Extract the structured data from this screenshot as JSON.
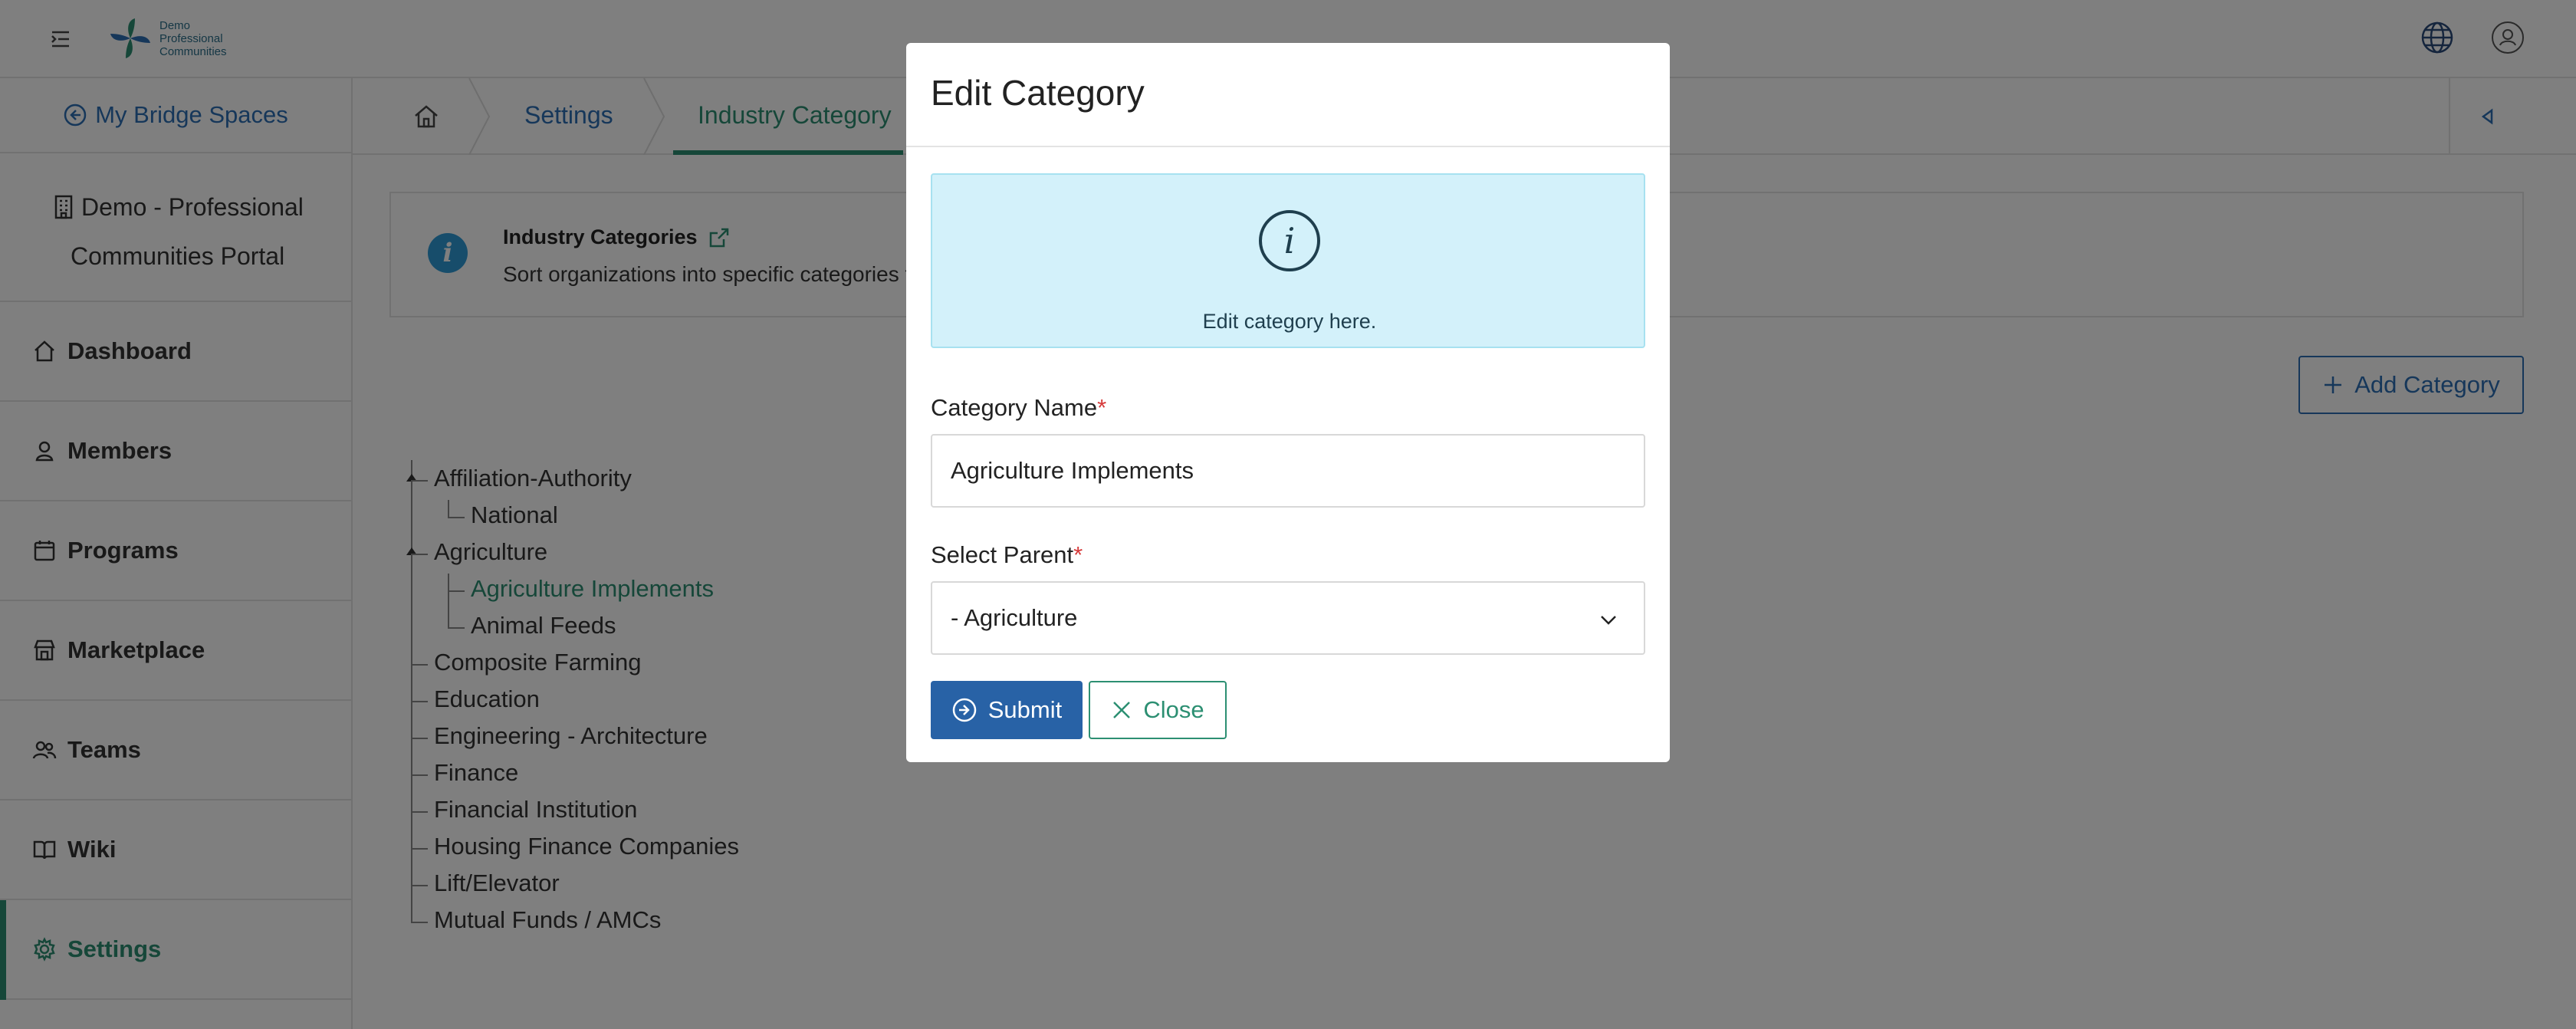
{
  "header": {
    "logo_lines": [
      "Demo",
      "Professional",
      "Communities"
    ]
  },
  "sidebar": {
    "bridge_label": "My Bridge Spaces",
    "org_line1": "Demo - Professional",
    "org_line2": "Communities Portal",
    "items": [
      {
        "label": "Dashboard",
        "icon": "home-icon"
      },
      {
        "label": "Members",
        "icon": "user-icon"
      },
      {
        "label": "Programs",
        "icon": "calendar-icon"
      },
      {
        "label": "Marketplace",
        "icon": "store-icon"
      },
      {
        "label": "Teams",
        "icon": "users-icon"
      },
      {
        "label": "Wiki",
        "icon": "book-icon"
      },
      {
        "label": "Settings",
        "icon": "gear-icon"
      }
    ],
    "active_item": "Settings"
  },
  "breadcrumb": {
    "items": [
      "Settings",
      "Industry Category"
    ]
  },
  "info": {
    "title": "Industry Categories",
    "description": "Sort organizations into specific categories t"
  },
  "add_category_label": "Add Category",
  "tree": {
    "nodes": [
      "Affiliation-Authority",
      "National",
      "Agriculture",
      "Agriculture Implements",
      "Animal Feeds",
      "Composite Farming",
      "Education",
      "Engineering - Architecture",
      "Finance",
      "Financial Institution",
      "Housing Finance Companies",
      "Lift/Elevator",
      "Mutual Funds / AMCs"
    ],
    "selected": "Agriculture Implements"
  },
  "modal": {
    "title": "Edit Category",
    "alert_text": "Edit category here.",
    "category_name_label": "Category Name",
    "category_name_value": "Agriculture Implements",
    "parent_label": "Select Parent",
    "parent_value": "- Agriculture",
    "required_mark": "*",
    "submit_label": "Submit",
    "close_label": "Close"
  },
  "colors": {
    "primary": "#2862a6",
    "accent": "#2c8f72",
    "info_bg": "#d3f1fa",
    "required": "#d63a3a"
  }
}
